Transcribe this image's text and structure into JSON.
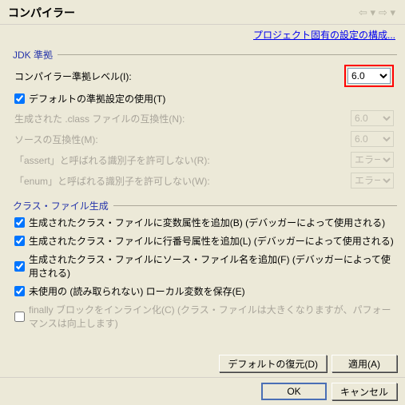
{
  "header": {
    "title": "コンパイラー"
  },
  "project_link": "プロジェクト固有の設定の構成...",
  "groups": {
    "jdk": {
      "title": "JDK 準拠",
      "rows": {
        "compliance_level": {
          "label": "コンパイラー準拠レベル(I):",
          "value": "6.0"
        },
        "use_default": {
          "label": "デフォルトの準拠設定の使用(T)",
          "checked": true
        },
        "class_compat": {
          "label": "生成された .class ファイルの互換性(N):",
          "value": "6.0"
        },
        "source_compat": {
          "label": "ソースの互換性(M):",
          "value": "6.0"
        },
        "assert_id": {
          "label": "「assert」と呼ばれる識別子を許可しない(R):",
          "value": "エラー"
        },
        "enum_id": {
          "label": "「enum」と呼ばれる識別子を許可しない(W):",
          "value": "エラー"
        }
      }
    },
    "classfile": {
      "title": "クラス・ファイル生成",
      "rows": {
        "var_attr": {
          "label": "生成されたクラス・ファイルに変数属性を追加(B) (デバッガーによって使用される)",
          "checked": true
        },
        "line_attr": {
          "label": "生成されたクラス・ファイルに行番号属性を追加(L) (デバッガーによって使用される)",
          "checked": true
        },
        "source_attr": {
          "label": "生成されたクラス・ファイルにソース・ファイル名を追加(F) (デバッガーによって使用される)",
          "checked": true
        },
        "unused_local": {
          "label": "未使用の (読み取られない) ローカル変数を保存(E)",
          "checked": true
        },
        "inline_finally": {
          "label": "finally ブロックをインライン化(C) (クラス・ファイルは大きくなりますが、パフォーマンスは向上します)",
          "checked": false
        }
      }
    }
  },
  "buttons": {
    "restore": "デフォルトの復元(D)",
    "apply": "適用(A)",
    "ok": "OK",
    "cancel": "キャンセル"
  }
}
